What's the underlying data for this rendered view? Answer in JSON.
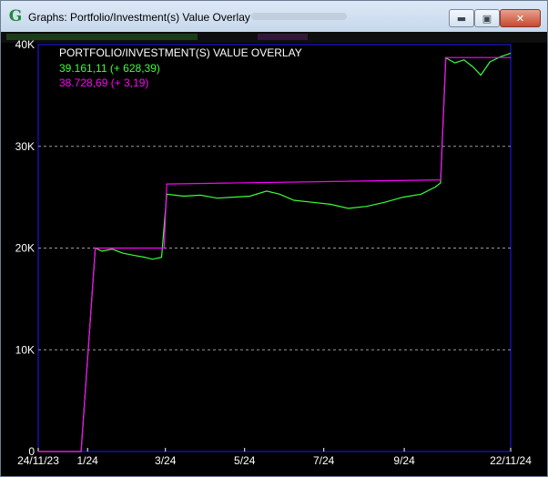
{
  "window": {
    "app_icon": "G",
    "title": "Graphs: Portfolio/Investment(s) Value Overlay",
    "controls": {
      "minimize": "▬",
      "maximize": "▣",
      "close": "✕"
    }
  },
  "chart_data": {
    "type": "line",
    "title": "PORTFOLIO/INVESTMENT(S) VALUE OVERLAY",
    "legend": [
      "39.161,11 (+ 628,39)",
      "38.728,69 (+ 3,19)"
    ],
    "x_ticks": [
      {
        "label": "24/11/23",
        "date": "2023-11-24"
      },
      {
        "label": "1/24",
        "date": "2024-01-01"
      },
      {
        "label": "3/24",
        "date": "2024-03-01"
      },
      {
        "label": "5/24",
        "date": "2024-05-01"
      },
      {
        "label": "7/24",
        "date": "2024-07-01"
      },
      {
        "label": "9/24",
        "date": "2024-09-01"
      },
      {
        "label": "22/11/24",
        "date": "2024-11-22"
      }
    ],
    "xlim": [
      "2023-11-24",
      "2024-11-22"
    ],
    "y_ticks": [
      {
        "label": "0",
        "value": 0
      },
      {
        "label": "10K",
        "value": 10000
      },
      {
        "label": "20K",
        "value": 20000
      },
      {
        "label": "30K",
        "value": 30000
      },
      {
        "label": "40K",
        "value": 40000
      }
    ],
    "ylim": [
      0,
      40000
    ],
    "grid": "horizontal dashed",
    "legend_position": "top-left",
    "series": [
      {
        "color": "#39ff39",
        "points": [
          [
            "2023-11-24",
            0
          ],
          [
            "2023-12-27",
            0
          ],
          [
            "2024-01-07",
            20000
          ],
          [
            "2024-01-12",
            19700
          ],
          [
            "2024-01-20",
            19900
          ],
          [
            "2024-01-28",
            19500
          ],
          [
            "2024-02-05",
            19300
          ],
          [
            "2024-02-14",
            19100
          ],
          [
            "2024-02-20",
            18900
          ],
          [
            "2024-02-27",
            19100
          ],
          [
            "2024-03-02",
            25300
          ],
          [
            "2024-03-15",
            25100
          ],
          [
            "2024-03-28",
            25200
          ],
          [
            "2024-04-10",
            24900
          ],
          [
            "2024-04-22",
            25000
          ],
          [
            "2024-05-05",
            25100
          ],
          [
            "2024-05-18",
            25600
          ],
          [
            "2024-05-28",
            25300
          ],
          [
            "2024-06-08",
            24700
          ],
          [
            "2024-06-22",
            24500
          ],
          [
            "2024-07-06",
            24300
          ],
          [
            "2024-07-20",
            23900
          ],
          [
            "2024-08-03",
            24100
          ],
          [
            "2024-08-17",
            24500
          ],
          [
            "2024-08-31",
            25000
          ],
          [
            "2024-09-14",
            25300
          ],
          [
            "2024-09-25",
            26000
          ],
          [
            "2024-09-29",
            26400
          ],
          [
            "2024-10-03",
            38700
          ],
          [
            "2024-10-10",
            38200
          ],
          [
            "2024-10-17",
            38500
          ],
          [
            "2024-10-24",
            37800
          ],
          [
            "2024-10-30",
            37000
          ],
          [
            "2024-11-06",
            38300
          ],
          [
            "2024-11-14",
            38800
          ],
          [
            "2024-11-22",
            39161
          ]
        ]
      },
      {
        "color": "#ff00ff",
        "points": [
          [
            "2023-11-24",
            0
          ],
          [
            "2023-12-27",
            0
          ],
          [
            "2024-01-07",
            20000
          ],
          [
            "2024-02-29",
            20000
          ],
          [
            "2024-03-02",
            26300
          ],
          [
            "2024-09-29",
            26700
          ],
          [
            "2024-10-03",
            38726
          ],
          [
            "2024-11-22",
            38729
          ]
        ]
      }
    ]
  }
}
